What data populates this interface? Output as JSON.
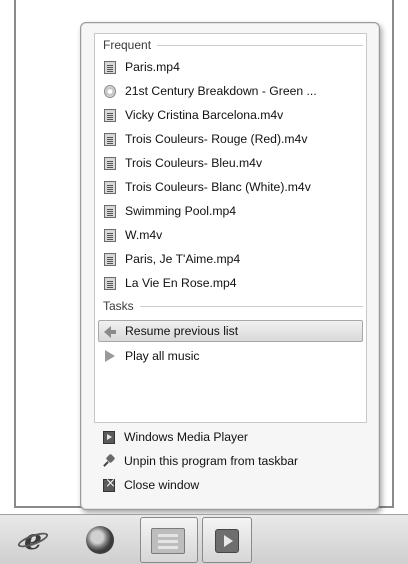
{
  "jumplist": {
    "frequent_header": "Frequent",
    "frequent_items": [
      {
        "label": "Paris.mp4",
        "icon": "video-file-icon"
      },
      {
        "label": "21st Century Breakdown - Green ...",
        "icon": "cd-icon"
      },
      {
        "label": "Vicky Cristina Barcelona.m4v",
        "icon": "video-file-icon"
      },
      {
        "label": "Trois Couleurs- Rouge (Red).m4v",
        "icon": "video-file-icon"
      },
      {
        "label": "Trois Couleurs- Bleu.m4v",
        "icon": "video-file-icon"
      },
      {
        "label": "Trois Couleurs- Blanc (White).m4v",
        "icon": "video-file-icon"
      },
      {
        "label": "Swimming Pool.mp4",
        "icon": "video-file-icon"
      },
      {
        "label": "W.m4v",
        "icon": "video-file-icon"
      },
      {
        "label": "Paris, Je T'Aime.mp4",
        "icon": "video-file-icon"
      },
      {
        "label": "La Vie En Rose.mp4",
        "icon": "video-file-icon"
      }
    ],
    "tasks_header": "Tasks",
    "tasks": [
      {
        "label": "Resume previous list",
        "icon": "arrow-left-icon",
        "highlighted": true
      },
      {
        "label": "Play all music",
        "icon": "play-icon",
        "highlighted": false
      }
    ],
    "bottom_items": [
      {
        "label": "Windows Media Player",
        "icon": "windows-media-player-icon"
      },
      {
        "label": "Unpin this program from taskbar",
        "icon": "pin-icon"
      },
      {
        "label": "Close window",
        "icon": "close-window-icon"
      }
    ]
  },
  "taskbar": {
    "buttons": [
      {
        "icon": "internet-explorer-icon",
        "active": false
      },
      {
        "icon": "firefox-icon",
        "active": false
      },
      {
        "icon": "windows-explorer-icon",
        "active": true
      },
      {
        "icon": "windows-media-player-icon",
        "active": true
      }
    ]
  }
}
